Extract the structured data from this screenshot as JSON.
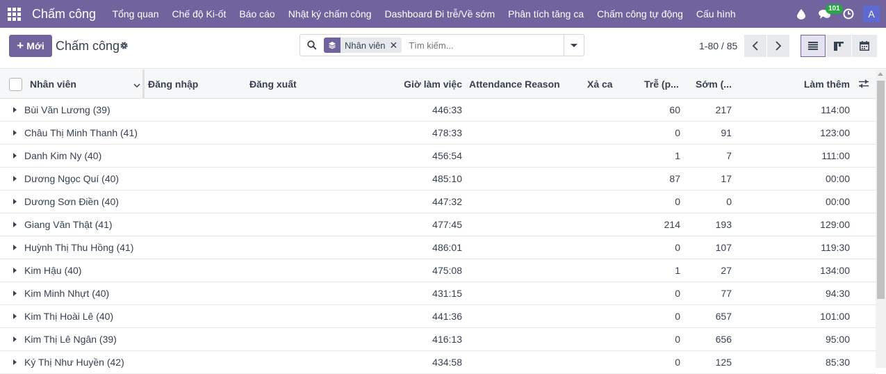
{
  "navbar": {
    "brand": "Chấm công",
    "menu": [
      "Tổng quan",
      "Chế độ Ki-ốt",
      "Báo cáo",
      "Nhật ký chấm công",
      "Dashboard Đi trễ/Về sớm",
      "Phân tích tăng ca",
      "Chấm công tự động",
      "Cấu hình"
    ],
    "messages_badge": "101",
    "avatar_letter": "A"
  },
  "control": {
    "new_button": "Mới",
    "title": "Chấm công",
    "facet": "Nhân viên",
    "search_placeholder": "Tìm kiếm...",
    "pager": "1-80 / 85"
  },
  "table": {
    "headers": {
      "employee": "Nhân viên",
      "check_in": "Đăng nhập",
      "check_out": "Đăng xuất",
      "worked_hours": "Giờ làm việc",
      "reason": "Attendance Reason",
      "break": "Xả ca",
      "late": "Trễ (p...",
      "early": "Sớm (...",
      "overtime": "Làm thêm"
    },
    "rows": [
      {
        "name": "Bùi Văn Lương (39)",
        "hours": "446:33",
        "late": "60",
        "early": "217",
        "overtime": "114:00"
      },
      {
        "name": "Châu Thị Minh Thanh (41)",
        "hours": "478:33",
        "late": "0",
        "early": "91",
        "overtime": "123:00"
      },
      {
        "name": "Danh Kim Ny (40)",
        "hours": "456:54",
        "late": "1",
        "early": "7",
        "overtime": "111:00"
      },
      {
        "name": "Dương Ngọc Quí (40)",
        "hours": "485:10",
        "late": "87",
        "early": "17",
        "overtime": "00:00"
      },
      {
        "name": "Dương Sơn Điền (40)",
        "hours": "447:32",
        "late": "0",
        "early": "0",
        "overtime": "00:00"
      },
      {
        "name": "Giang Văn Thật (41)",
        "hours": "477:45",
        "late": "214",
        "early": "193",
        "overtime": "129:00"
      },
      {
        "name": "Huỳnh Thị Thu Hồng (41)",
        "hours": "486:01",
        "late": "0",
        "early": "107",
        "overtime": "119:30"
      },
      {
        "name": "Kim Hậu (40)",
        "hours": "475:08",
        "late": "1",
        "early": "27",
        "overtime": "134:00"
      },
      {
        "name": "Kim Minh Nhựt (40)",
        "hours": "431:15",
        "late": "0",
        "early": "77",
        "overtime": "94:30"
      },
      {
        "name": "Kim Thị Hoài Lê (40)",
        "hours": "441:36",
        "late": "0",
        "early": "657",
        "overtime": "101:00"
      },
      {
        "name": "Kim Thị Lê Ngân (39)",
        "hours": "416:13",
        "late": "0",
        "early": "656",
        "overtime": "95:00"
      },
      {
        "name": "Ký Thị Như Huyền (42)",
        "hours": "434:58",
        "late": "0",
        "early": "125",
        "overtime": "85:30"
      }
    ]
  }
}
